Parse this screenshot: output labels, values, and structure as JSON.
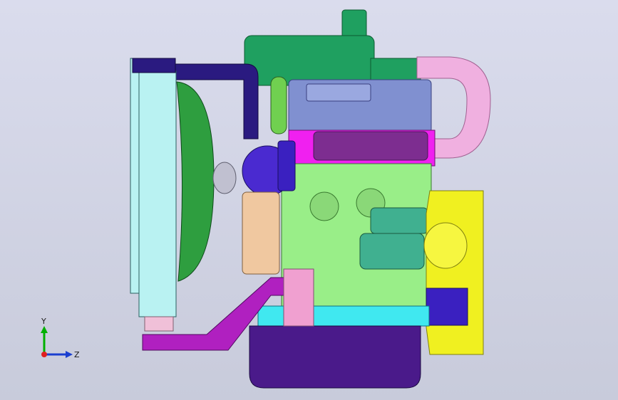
{
  "viewport": {
    "background_top": "#d9dcea",
    "background_bottom": "#c9ccdc"
  },
  "triad": {
    "y_label": "Y",
    "z_label": "Z",
    "y_color": "#00b000",
    "z_color": "#1a3fd0",
    "x_color": "#e02020"
  },
  "parts": {
    "radiator_color": "#b9f2f2",
    "fan_color": "#2e9e3f",
    "pipe_color": "#2a1a80",
    "air_filter_color": "#1fa060",
    "pink_pipe_color": "#f0b0e0",
    "valve_cover_color": "#8090d0",
    "manifold_color": "#f020f0",
    "block_color": "#99ee88",
    "alternator_color": "#4a2ad0",
    "starter_color": "#40b090",
    "flywheel_color": "#f0f020",
    "bracket_color": "#b020c0",
    "oil_pan_color": "#4a1a8a",
    "sump_strip_color": "#40e8f0",
    "belt_housing_color": "#f0c8a0"
  }
}
